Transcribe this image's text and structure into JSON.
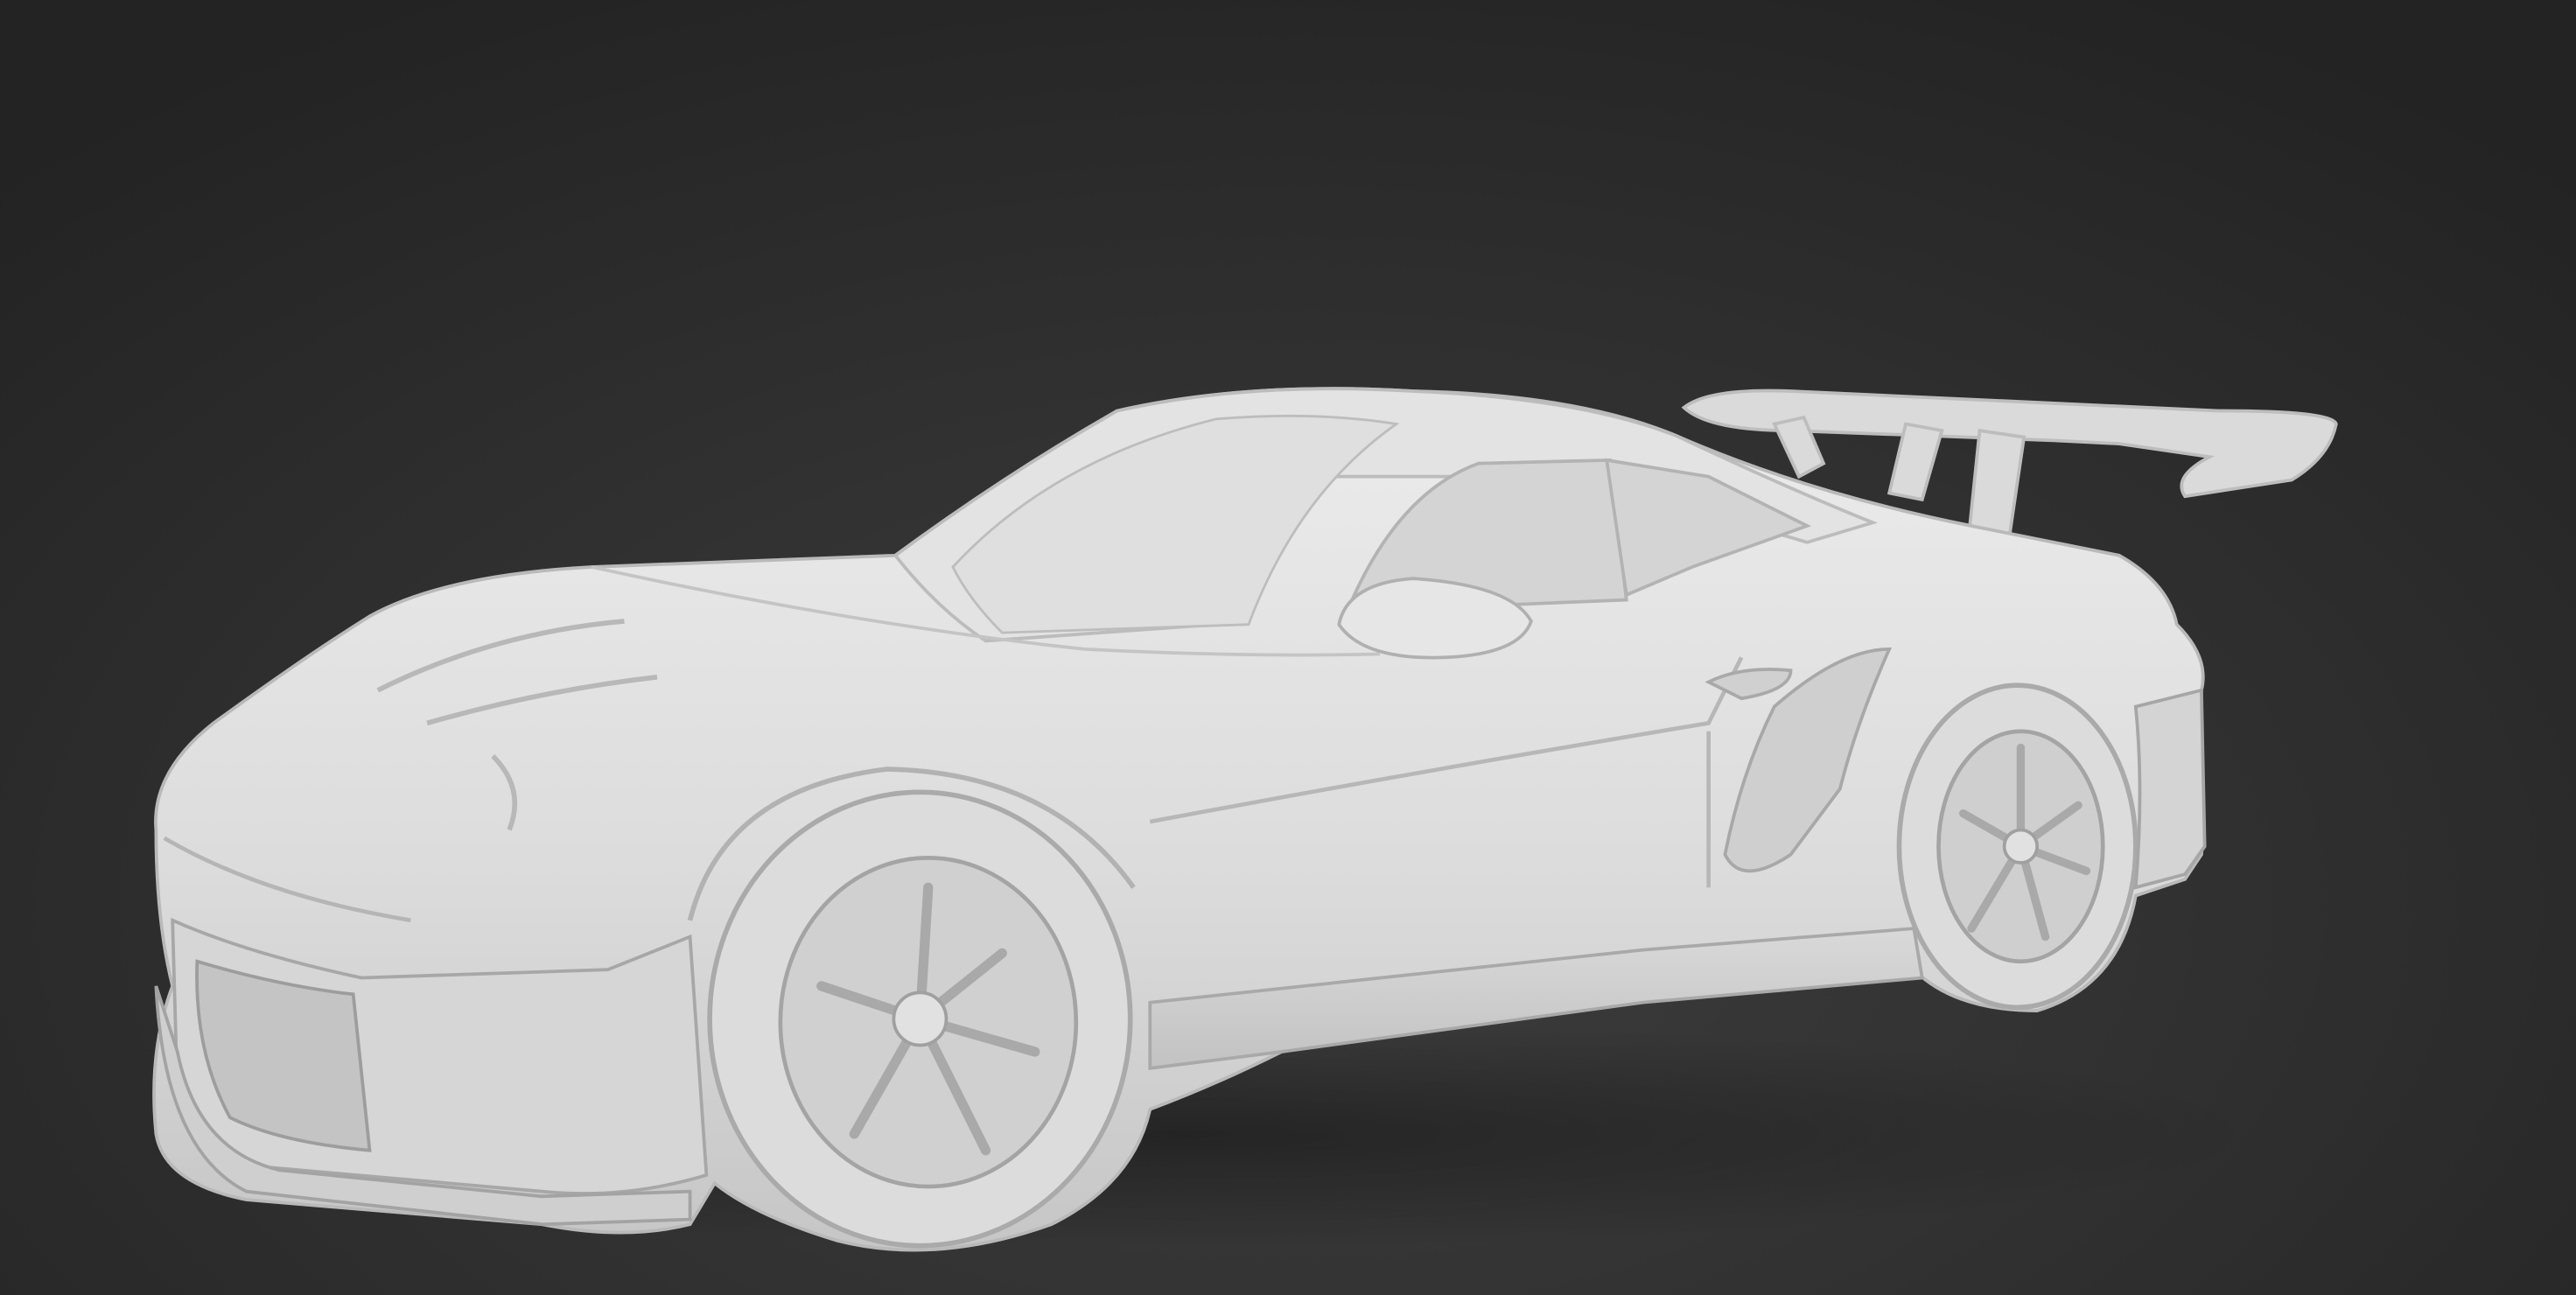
{
  "viewport": {
    "background_top": "#1f1f1f",
    "background_bottom": "#3a3a3a"
  },
  "model": {
    "subject": "race-car-sculpt",
    "material_color": "#dedede",
    "shadow_color": "#a9a9a9",
    "highlight_color": "#efefef"
  }
}
